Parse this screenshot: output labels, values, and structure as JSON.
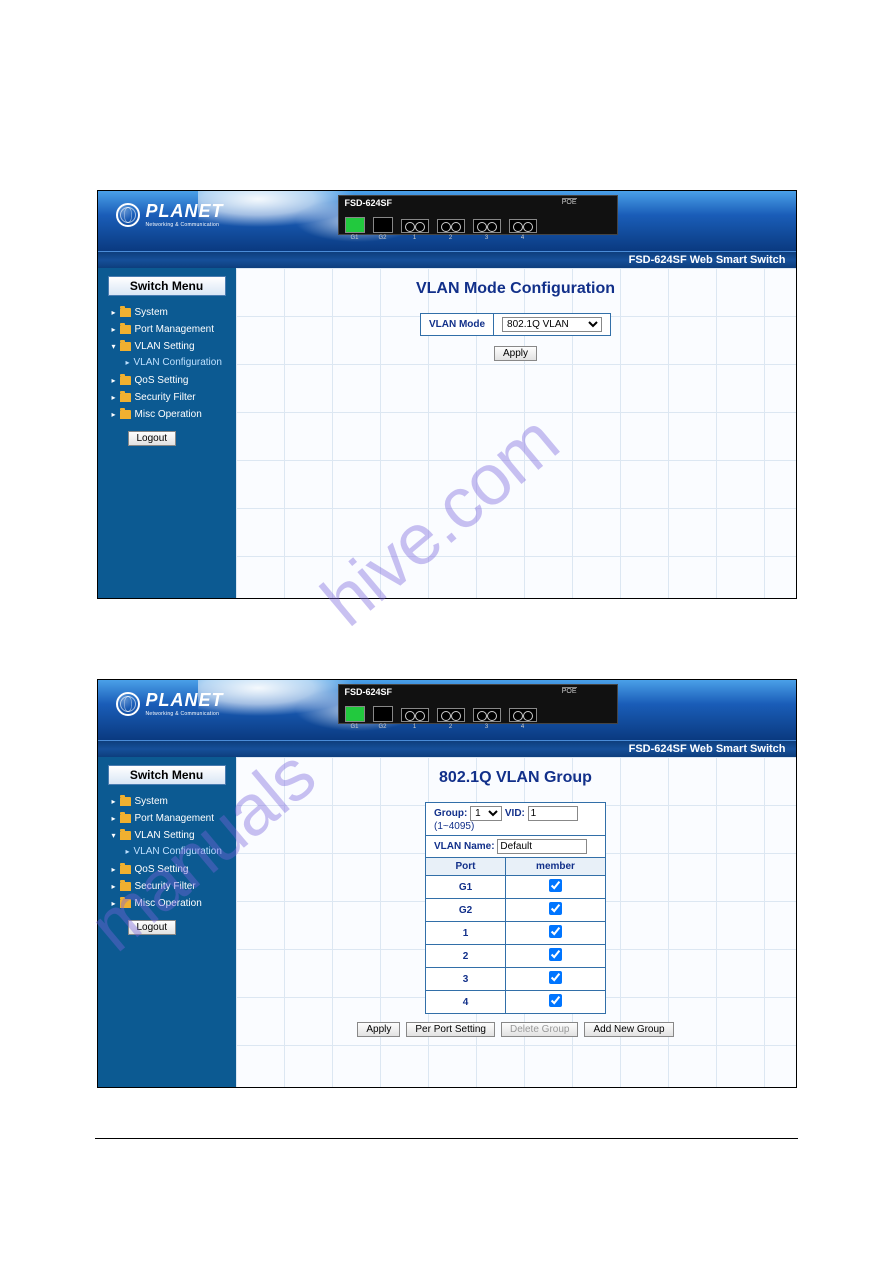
{
  "device_model": "FSD-624SF",
  "header_right": "FSD-624SF Web Smart Switch",
  "logo": {
    "brand": "PLANET",
    "sub": "Networking & Communication"
  },
  "device_ports": {
    "poe_label": "POE",
    "ports": [
      {
        "name": "G1",
        "label": "G1"
      },
      {
        "name": "G2",
        "label": "G2"
      },
      {
        "name": "1",
        "label": "1"
      },
      {
        "name": "2",
        "label": "2"
      },
      {
        "name": "3",
        "label": "3"
      },
      {
        "name": "4",
        "label": "4"
      }
    ]
  },
  "sidebar": {
    "title": "Switch Menu",
    "items": [
      {
        "label": "System"
      },
      {
        "label": "Port Management"
      },
      {
        "label": "VLAN Setting",
        "sub": [
          {
            "label": "VLAN Configuration"
          }
        ]
      },
      {
        "label": "QoS Setting"
      },
      {
        "label": "Security Filter"
      },
      {
        "label": "Misc Operation"
      }
    ],
    "logout": "Logout"
  },
  "panel1": {
    "title": "VLAN Mode Configuration",
    "mode_label": "VLAN Mode",
    "mode_value": "802.1Q VLAN",
    "apply": "Apply"
  },
  "panel2": {
    "title": "802.1Q VLAN Group",
    "group_label": "Group:",
    "group_value": "1",
    "vid_label": "VID:",
    "vid_value": "1",
    "vid_range": "(1~4095)",
    "vlan_name_label": "VLAN Name:",
    "vlan_name_value": "Default",
    "col_port": "Port",
    "col_member": "member",
    "rows": [
      {
        "port": "G1",
        "member": true
      },
      {
        "port": "G2",
        "member": true
      },
      {
        "port": "1",
        "member": true
      },
      {
        "port": "2",
        "member": true
      },
      {
        "port": "3",
        "member": true
      },
      {
        "port": "4",
        "member": true
      }
    ],
    "buttons": {
      "apply": "Apply",
      "per_port": "Per Port Setting",
      "delete_group": "Delete Group",
      "add_new": "Add New Group"
    }
  }
}
